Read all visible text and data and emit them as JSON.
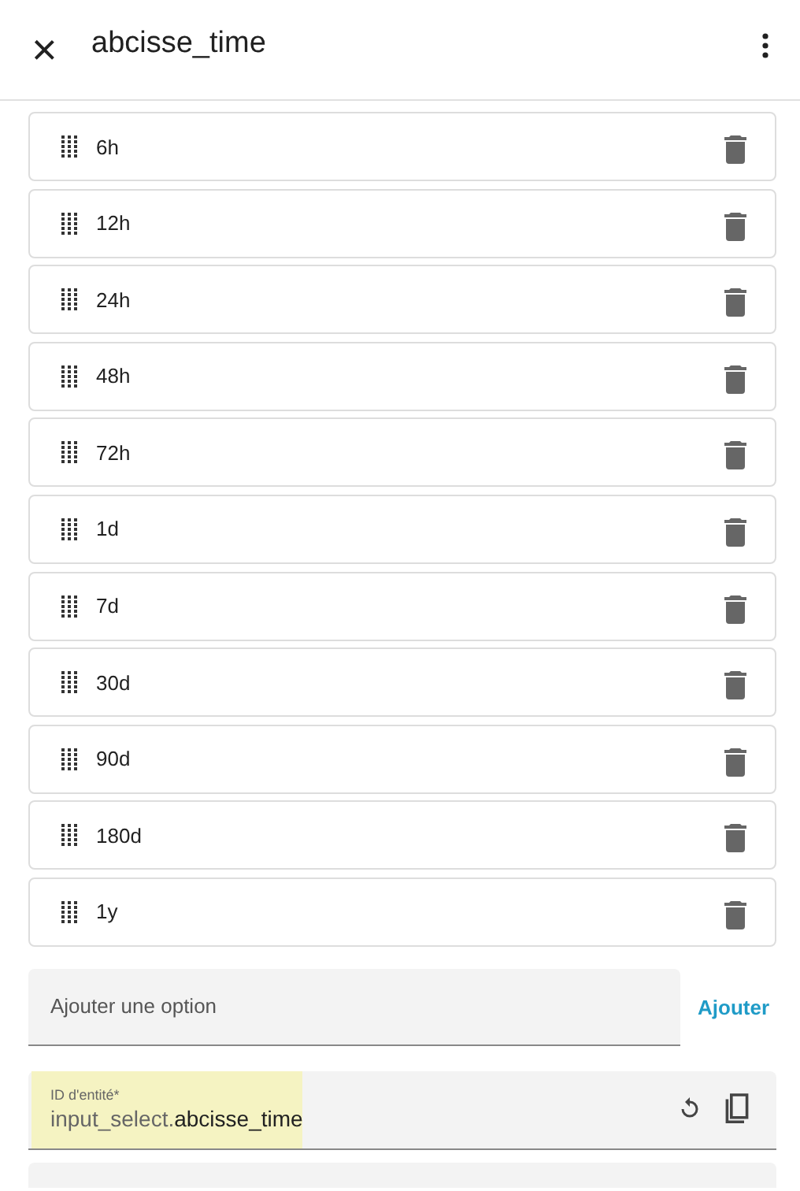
{
  "header": {
    "close": "×",
    "title": "abcisse_time"
  },
  "options": [
    {
      "label": "6h"
    },
    {
      "label": "12h"
    },
    {
      "label": "24h"
    },
    {
      "label": "48h"
    },
    {
      "label": "72h"
    },
    {
      "label": "1d"
    },
    {
      "label": "7d"
    },
    {
      "label": "30d"
    },
    {
      "label": "90d"
    },
    {
      "label": "180d"
    },
    {
      "label": "1y"
    }
  ],
  "add_option": {
    "placeholder": "Ajouter une option",
    "button": "Ajouter"
  },
  "entity_id": {
    "label": "ID d'entité*",
    "prefix": "input_select.",
    "value": "abcisse_time",
    "highlighted": true
  }
}
